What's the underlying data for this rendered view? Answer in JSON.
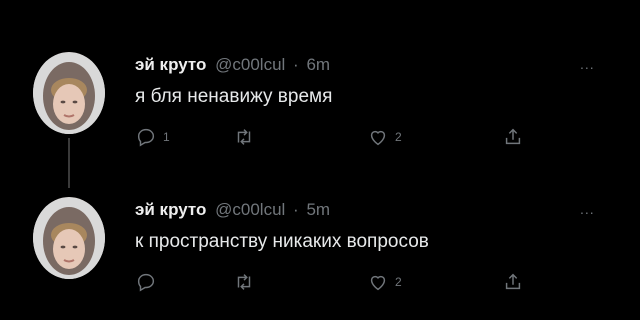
{
  "tweets": [
    {
      "author_name": "эй круто",
      "handle": "@c00lcul",
      "separator": "·",
      "time": "6m",
      "text": "я бля ненавижу время",
      "more": "...",
      "reply_count": "1",
      "retweet_count": "",
      "like_count": "2"
    },
    {
      "author_name": "эй круто",
      "handle": "@c00lcul",
      "separator": "·",
      "time": "5m",
      "text": "к пространству никаких вопросов",
      "more": "...",
      "reply_count": "",
      "retweet_count": "",
      "like_count": "2"
    }
  ],
  "colors": {
    "background": "#000000",
    "text": "#e7e9ea",
    "muted": "#71767b"
  },
  "icons": [
    "reply-icon",
    "retweet-icon",
    "like-icon",
    "share-icon",
    "more-icon"
  ]
}
